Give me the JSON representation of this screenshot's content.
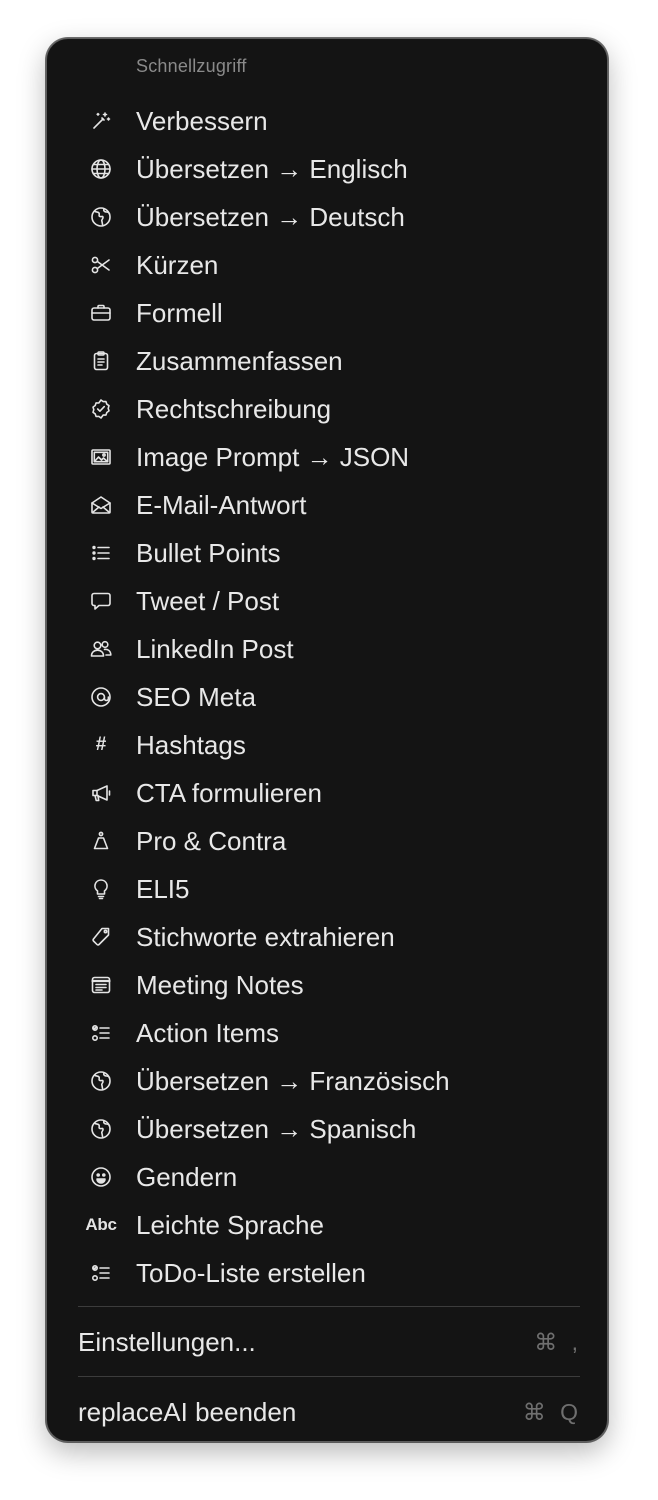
{
  "menu": {
    "section_title": "Schnellzugriff",
    "items": [
      {
        "label": "Verbessern",
        "icon": "magic-wand-icon"
      },
      {
        "label": "Übersetzen → Englisch",
        "icon": "globe-icon"
      },
      {
        "label": "Übersetzen → Deutsch",
        "icon": "globe-europe-icon"
      },
      {
        "label": "Kürzen",
        "icon": "scissors-icon"
      },
      {
        "label": "Formell",
        "icon": "briefcase-icon"
      },
      {
        "label": "Zusammenfassen",
        "icon": "clipboard-icon"
      },
      {
        "label": "Rechtschreibung",
        "icon": "check-seal-icon"
      },
      {
        "label": "Image Prompt → JSON",
        "icon": "photo-icon"
      },
      {
        "label": "E-Mail-Antwort",
        "icon": "envelope-open-icon"
      },
      {
        "label": "Bullet Points",
        "icon": "list-bullet-icon"
      },
      {
        "label": "Tweet / Post",
        "icon": "speech-bubble-icon"
      },
      {
        "label": "LinkedIn Post",
        "icon": "people-icon"
      },
      {
        "label": "SEO Meta",
        "icon": "at-sign-icon"
      },
      {
        "label": "Hashtags",
        "icon": "hashtag-icon"
      },
      {
        "label": "CTA formulieren",
        "icon": "megaphone-icon"
      },
      {
        "label": "Pro & Contra",
        "icon": "scale-icon"
      },
      {
        "label": "ELI5",
        "icon": "lightbulb-icon"
      },
      {
        "label": "Stichworte extrahieren",
        "icon": "tag-icon"
      },
      {
        "label": "Meeting Notes",
        "icon": "note-icon"
      },
      {
        "label": "Action Items",
        "icon": "checklist-icon"
      },
      {
        "label": "Übersetzen → Französisch",
        "icon": "globe-europe-icon"
      },
      {
        "label": "Übersetzen → Spanisch",
        "icon": "globe-europe-icon"
      },
      {
        "label": "Gendern",
        "icon": "smiley-icon"
      },
      {
        "label": "Leichte Sprache",
        "icon": "abc-icon"
      },
      {
        "label": "ToDo-Liste erstellen",
        "icon": "checklist-icon"
      }
    ],
    "abc_icon_text": "Abc",
    "hashtag_icon_text": "#",
    "settings": {
      "label": "Einstellungen...",
      "shortcut": "⌘ ,"
    },
    "quit": {
      "label": "replaceAI beenden",
      "shortcut": "⌘ Q"
    }
  }
}
